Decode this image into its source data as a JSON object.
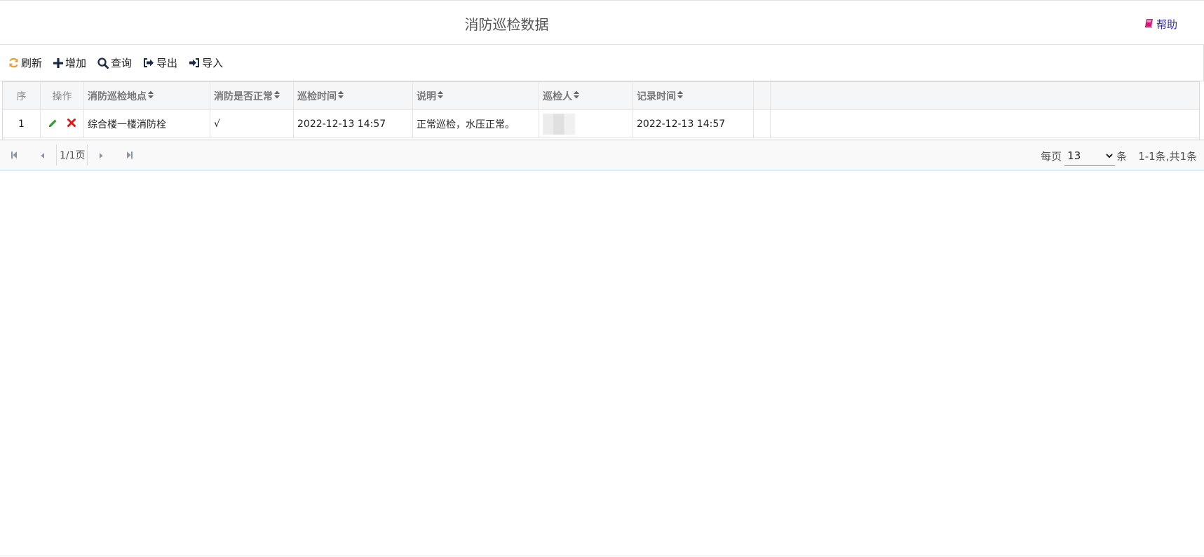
{
  "header": {
    "title": "消防巡检数据",
    "help_label": "帮助"
  },
  "toolbar": {
    "refresh_label": "刷新",
    "add_label": "增加",
    "query_label": "查询",
    "export_label": "导出",
    "import_label": "导入"
  },
  "grid": {
    "columns": {
      "index": "序",
      "actions": "操作",
      "location": "消防巡检地点",
      "is_normal": "消防是否正常",
      "inspect_time": "巡检时间",
      "description": "说明",
      "inspector": "巡检人",
      "record_time": "记录时间"
    },
    "rows": [
      {
        "index": "1",
        "location": "综合楼一楼消防栓",
        "is_normal": "√",
        "inspect_time": "2022-12-13 14:57",
        "description": "正常巡检，水压正常。",
        "record_time": "2022-12-13 14:57"
      }
    ]
  },
  "pager": {
    "page_info": "1/1页",
    "per_page_label": "每页",
    "page_size": "13",
    "page_size_options": [
      "13"
    ],
    "unit_label": "条",
    "range_text": "1-1条,共1条"
  },
  "colors": {
    "refresh_icon": "#f0a030",
    "edit_icon": "#3a9a3a",
    "delete_icon": "#e01818",
    "help_icon": "#d0187a",
    "toolbar_icon": "#1c2a4a"
  }
}
